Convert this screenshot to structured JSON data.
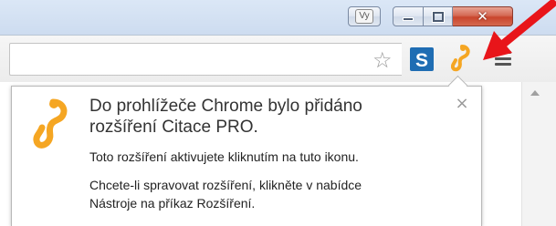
{
  "window": {
    "profile_label": "Vy",
    "close_glyph": "✕"
  },
  "toolbar": {
    "bookmark_star": "☆",
    "extension_s_letter": "S"
  },
  "bubble": {
    "title_line1": "Do prohlížeče Chrome bylo přidáno",
    "title_line2": "rozšíření Citace PRO.",
    "text1": "Toto rozšíření aktivujete kliknutím na tuto ikonu.",
    "text2_line1": "Chcete-li spravovat rozšíření, klikněte v nabídce",
    "text2_line2": "Nástroje na příkaz Rozšíření.",
    "close_glyph": "×"
  },
  "colors": {
    "citace_orange": "#f5a623",
    "arrow_red": "#e8151a",
    "s_blue": "#1f6db3"
  },
  "icons": [
    "star-icon",
    "s-extension-icon",
    "citace-pro-icon",
    "menu-icon",
    "close-icon",
    "red-arrow"
  ]
}
